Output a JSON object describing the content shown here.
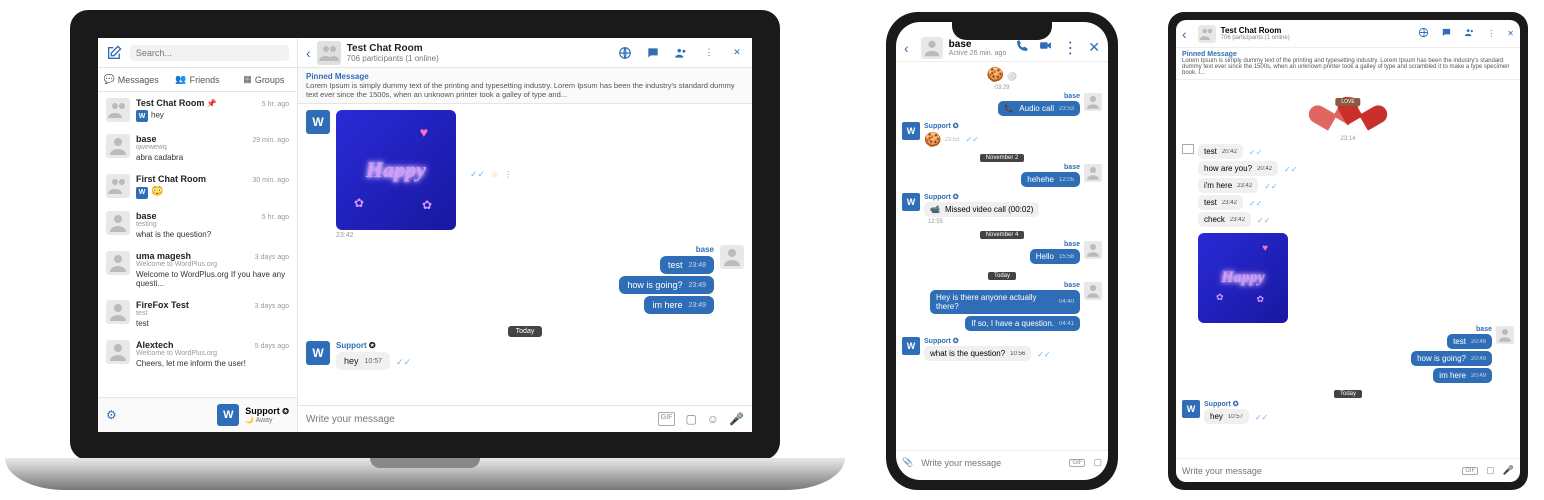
{
  "laptop": {
    "search_placeholder": "Search...",
    "room": {
      "title": "Test Chat Room",
      "participants": "706 participants (1 online)"
    },
    "tabs": {
      "messages": "Messages",
      "friends": "Friends",
      "groups": "Groups"
    },
    "conversations": [
      {
        "name": "Test Chat Room",
        "time": "5 hr. ago",
        "msg": "hey",
        "pinned": true,
        "w_badge": true
      },
      {
        "name": "base",
        "time": "29 min. ago",
        "sub": "qwewewq",
        "msg": "abra cadabra"
      },
      {
        "name": "First Chat Room",
        "time": "30 min. ago",
        "w_badge": true,
        "emoji": "😳"
      },
      {
        "name": "base",
        "time": "5 hr. ago",
        "sub": "testing",
        "msg": "what is the question?"
      },
      {
        "name": "uma magesh",
        "time": "3 days ago",
        "sub": "Welcome to WordPlus.org",
        "msg": "Welcome to WordPlus.org If you have any questi..."
      },
      {
        "name": "FireFox Test",
        "time": "3 days ago",
        "sub": "test",
        "msg": "test"
      },
      {
        "name": "Alextech",
        "time": "5 days ago",
        "sub": "Welcome to WordPlus.org",
        "msg": "Cheers, let me inform the user!"
      }
    ],
    "current_user": {
      "name": "Support",
      "status": "Away",
      "avatar": "W"
    },
    "pinned": {
      "title": "Pinned Message",
      "text": "Lorem Ipsum is simply dummy text of the printing and typesetting industry. Lorem Ipsum has been the industry's standard dummy text ever since the 1500s, when an unknown printer took a galley of type and..."
    },
    "messages": {
      "happy_time": "23:42",
      "base_sender": "base",
      "out": [
        {
          "text": "test",
          "time": "23:48"
        },
        {
          "text": "how is going?",
          "time": "23:49"
        },
        {
          "text": "im here",
          "time": "23:49"
        }
      ],
      "today": "Today",
      "support_sender": "Support",
      "support_msg": {
        "text": "hey",
        "time": "10:57"
      }
    },
    "compose_placeholder": "Write your message"
  },
  "phone": {
    "header": {
      "name": "base",
      "status": "Active 26 min. ago"
    },
    "time1": "03:29",
    "nov2": "November 2",
    "nov4": "November 4",
    "today": "Today",
    "msgs": {
      "audio_call": "Audio call",
      "audio_time": "23:53",
      "sender_base": "base",
      "sender_support": "Support",
      "emoji_time": "23:53",
      "hehehe": "hehehe",
      "hehehe_time": "12:05",
      "missed": "Missed video call (00:02)",
      "missed_time": "12:55",
      "hello": "Hello",
      "hello_time": "15:58",
      "q1": "Hey is there anyone actually there?",
      "q1_time": "04:40",
      "q2": "If so, I have a question.",
      "q2_time": "04:41",
      "wq": "what is the question?",
      "wq_time": "10:56"
    },
    "compose_placeholder": "Write your message"
  },
  "tablet": {
    "room": {
      "title": "Test Chat Room",
      "participants": "706 participants (1 online)"
    },
    "pinned": {
      "title": "Pinned Message",
      "text": "Lorem Ipsum is simply dummy text of the printing and typesetting industry. Lorem Ipsum has been the industry's standard dummy text ever since the 1500s, when an unknown printer took a galley of type and scrambled it to make a type specimen book. I..."
    },
    "love_label": "LOVE",
    "time_center": "23:14",
    "in_msgs": [
      {
        "text": "test",
        "time": "20:42"
      },
      {
        "text": "how are you?",
        "time": "20:42"
      },
      {
        "text": "i'm here",
        "time": "23:42"
      },
      {
        "text": "test",
        "time": "23:42"
      },
      {
        "text": "check",
        "time": "23:42"
      }
    ],
    "sender_base": "base",
    "out_msgs": [
      {
        "text": "test",
        "time": "20:48"
      },
      {
        "text": "how is going?",
        "time": "20:49"
      },
      {
        "text": "im here",
        "time": "20:49"
      }
    ],
    "today": "Today",
    "sender_support": "Support",
    "support_msg": {
      "text": "hey",
      "time": "10:57"
    },
    "compose_placeholder": "Write your message"
  }
}
